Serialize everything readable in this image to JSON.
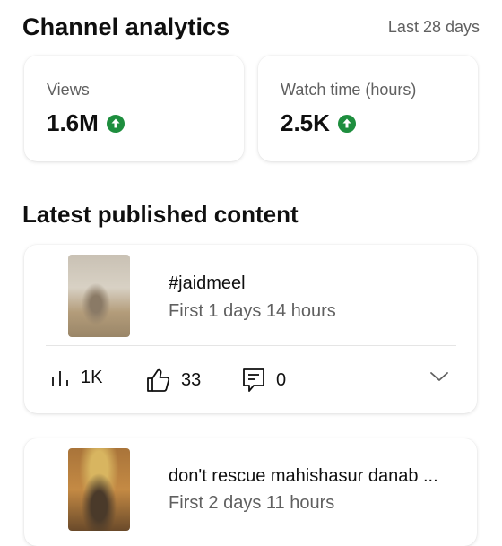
{
  "header": {
    "title": "Channel analytics",
    "range": "Last 28 days"
  },
  "stats": [
    {
      "label": "Views",
      "value": "1.6M",
      "trend": "up"
    },
    {
      "label": "Watch time (hours)",
      "value": "2.5K",
      "trend": "up"
    }
  ],
  "colors": {
    "trend_up": "#1e8e3e"
  },
  "section_title": "Latest published content",
  "content": [
    {
      "title": "#jaidmeel",
      "subtitle": "First 1 days 14 hours",
      "views": "1K",
      "likes": "33",
      "comments": "0"
    },
    {
      "title": "don't rescue mahishasur danab ...",
      "subtitle": "First 2 days 11 hours"
    }
  ],
  "icons": {
    "trend": "arrow-up-circle-icon",
    "views": "bar-chart-icon",
    "likes": "thumbs-up-icon",
    "comments": "comment-icon",
    "expand": "chevron-down-icon"
  }
}
